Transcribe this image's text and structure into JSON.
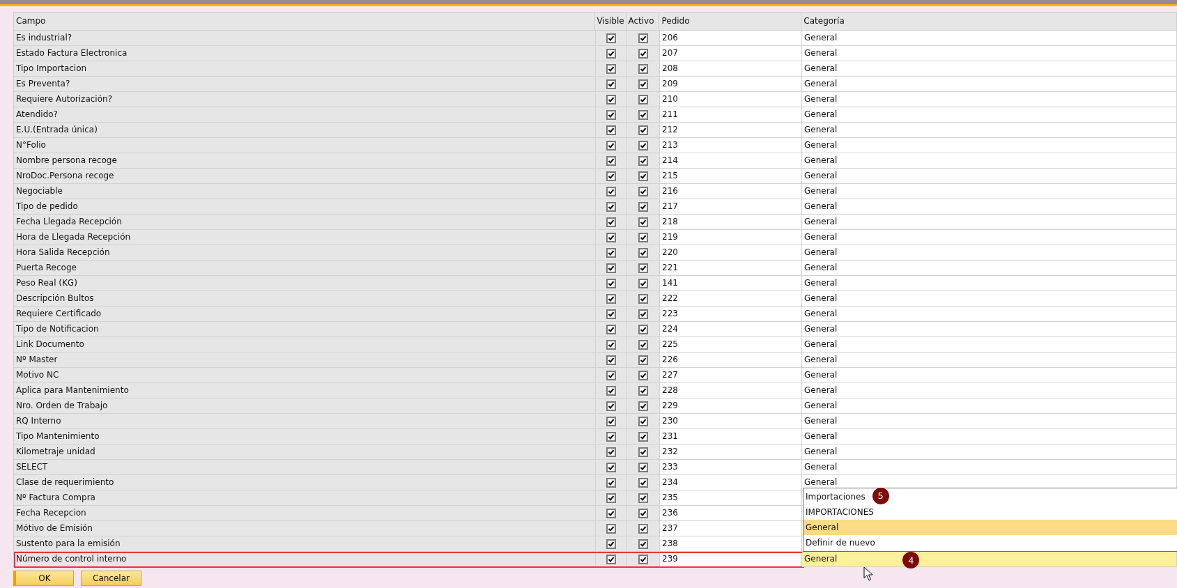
{
  "table": {
    "columns": [
      "Campo",
      "Visible",
      "Activo",
      "Pedido",
      "Categoría"
    ],
    "rows": [
      {
        "campo": "Es industrial?",
        "visible": true,
        "activo": true,
        "pedido": "206",
        "categoria": "General",
        "selected": false
      },
      {
        "campo": "Estado Factura Electronica",
        "visible": true,
        "activo": true,
        "pedido": "207",
        "categoria": "General",
        "selected": false
      },
      {
        "campo": "Tipo Importacion",
        "visible": true,
        "activo": true,
        "pedido": "208",
        "categoria": "General",
        "selected": false
      },
      {
        "campo": "Es Preventa?",
        "visible": true,
        "activo": true,
        "pedido": "209",
        "categoria": "General",
        "selected": false
      },
      {
        "campo": "Requiere Autorización?",
        "visible": true,
        "activo": true,
        "pedido": "210",
        "categoria": "General",
        "selected": false
      },
      {
        "campo": "Atendido?",
        "visible": true,
        "activo": true,
        "pedido": "211",
        "categoria": "General",
        "selected": false
      },
      {
        "campo": "E.U.(Entrada única)",
        "visible": true,
        "activo": true,
        "pedido": "212",
        "categoria": "General",
        "selected": false
      },
      {
        "campo": "N°Folio",
        "visible": true,
        "activo": true,
        "pedido": "213",
        "categoria": "General",
        "selected": false
      },
      {
        "campo": "Nombre persona recoge",
        "visible": true,
        "activo": true,
        "pedido": "214",
        "categoria": "General",
        "selected": false
      },
      {
        "campo": "NroDoc.Persona recoge",
        "visible": true,
        "activo": true,
        "pedido": "215",
        "categoria": "General",
        "selected": false
      },
      {
        "campo": "Negociable",
        "visible": true,
        "activo": true,
        "pedido": "216",
        "categoria": "General",
        "selected": false
      },
      {
        "campo": "Tipo de pedido",
        "visible": true,
        "activo": true,
        "pedido": "217",
        "categoria": "General",
        "selected": false
      },
      {
        "campo": "Fecha Llegada Recepción",
        "visible": true,
        "activo": true,
        "pedido": "218",
        "categoria": "General",
        "selected": false
      },
      {
        "campo": "Hora de Llegada Recepción",
        "visible": true,
        "activo": true,
        "pedido": "219",
        "categoria": "General",
        "selected": false
      },
      {
        "campo": "Hora Salida Recepción",
        "visible": true,
        "activo": true,
        "pedido": "220",
        "categoria": "General",
        "selected": false
      },
      {
        "campo": "Puerta Recoge",
        "visible": true,
        "activo": true,
        "pedido": "221",
        "categoria": "General",
        "selected": false
      },
      {
        "campo": "Peso Real (KG)",
        "visible": true,
        "activo": true,
        "pedido": "141",
        "categoria": "General",
        "selected": false
      },
      {
        "campo": "Descripción Bultos",
        "visible": true,
        "activo": true,
        "pedido": "222",
        "categoria": "General",
        "selected": false
      },
      {
        "campo": "Requiere Certificado",
        "visible": true,
        "activo": true,
        "pedido": "223",
        "categoria": "General",
        "selected": false
      },
      {
        "campo": "Tipo de Notificacion",
        "visible": true,
        "activo": true,
        "pedido": "224",
        "categoria": "General",
        "selected": false
      },
      {
        "campo": "Link Documento",
        "visible": true,
        "activo": true,
        "pedido": "225",
        "categoria": "General",
        "selected": false
      },
      {
        "campo": "Nº Master",
        "visible": true,
        "activo": true,
        "pedido": "226",
        "categoria": "General",
        "selected": false
      },
      {
        "campo": "Motivo NC",
        "visible": true,
        "activo": true,
        "pedido": "227",
        "categoria": "General",
        "selected": false
      },
      {
        "campo": "Aplica para Mantenimiento",
        "visible": true,
        "activo": true,
        "pedido": "228",
        "categoria": "General",
        "selected": false
      },
      {
        "campo": "Nro. Orden de Trabajo",
        "visible": true,
        "activo": true,
        "pedido": "229",
        "categoria": "General",
        "selected": false
      },
      {
        "campo": "RQ Interno",
        "visible": true,
        "activo": true,
        "pedido": "230",
        "categoria": "General",
        "selected": false
      },
      {
        "campo": "Tipo Mantenimiento",
        "visible": true,
        "activo": true,
        "pedido": "231",
        "categoria": "General",
        "selected": false
      },
      {
        "campo": "Kilometraje unidad",
        "visible": true,
        "activo": true,
        "pedido": "232",
        "categoria": "General",
        "selected": false
      },
      {
        "campo": "SELECT",
        "visible": true,
        "activo": true,
        "pedido": "233",
        "categoria": "General",
        "selected": false
      },
      {
        "campo": "Clase de requerimiento",
        "visible": true,
        "activo": true,
        "pedido": "234",
        "categoria": "General",
        "selected": false
      },
      {
        "campo": "Nº Factura Compra",
        "visible": true,
        "activo": true,
        "pedido": "235",
        "selected": false
      },
      {
        "campo": "Fecha Recepcion",
        "visible": true,
        "activo": true,
        "pedido": "236",
        "selected": false
      },
      {
        "campo": "Mótivo de Emisión",
        "visible": true,
        "activo": true,
        "pedido": "237",
        "selected": false
      },
      {
        "campo": "Sustento para la emisión",
        "visible": true,
        "activo": true,
        "pedido": "238",
        "selected": false
      },
      {
        "campo": "Número de control interno",
        "visible": true,
        "activo": true,
        "pedido": "239",
        "categoria": "General",
        "selected": true,
        "marker": "4",
        "dropdown": [
          {
            "label": "Importaciones",
            "selected": false,
            "marker": "5"
          },
          {
            "label": "IMPORTACIONES",
            "selected": false
          },
          {
            "label": "General",
            "selected": true
          },
          {
            "label": "Definir de nuevo",
            "selected": false
          }
        ]
      }
    ]
  },
  "buttons": [
    "OK",
    "Cancelar"
  ]
}
